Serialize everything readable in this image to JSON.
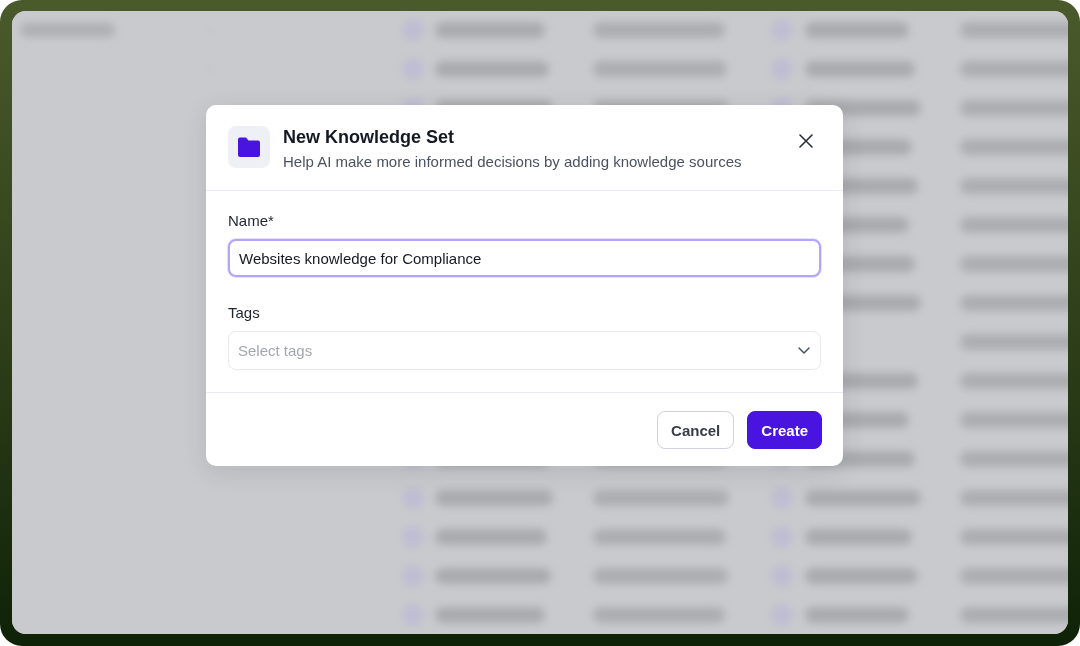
{
  "dialog": {
    "title": "New Knowledge Set",
    "subtitle": "Help AI make more informed decisions by adding knowledge sources",
    "fields": [
      {
        "kind": "text",
        "label": "Name*",
        "value": "Websites knowledge for Compliance",
        "focused": true
      },
      {
        "kind": "select",
        "label": "Tags",
        "placeholder": "Select tags",
        "focused": false
      }
    ],
    "buttons": [
      {
        "label": "Cancel",
        "kind": "secondary"
      },
      {
        "label": "Create",
        "kind": "primary"
      }
    ]
  }
}
